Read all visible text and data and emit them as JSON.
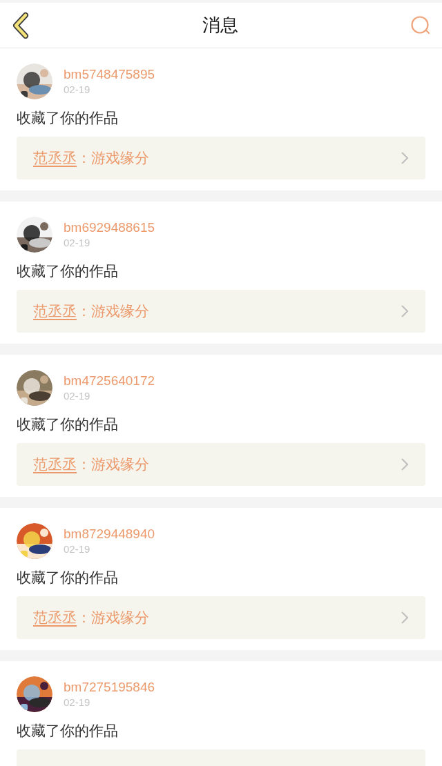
{
  "header": {
    "title": "消息"
  },
  "messages": [
    {
      "user": "bm5748475895",
      "date": "02-19",
      "action": "收藏了你的作品",
      "work": {
        "author": "范丞丞",
        "title": "：游戏缘分"
      }
    },
    {
      "user": "bm6929488615",
      "date": "02-19",
      "action": "收藏了你的作品",
      "work": {
        "author": "范丞丞",
        "title": "：游戏缘分"
      }
    },
    {
      "user": "bm4725640172",
      "date": "02-19",
      "action": "收藏了你的作品",
      "work": {
        "author": "范丞丞",
        "title": "：游戏缘分"
      }
    },
    {
      "user": "bm8729448940",
      "date": "02-19",
      "action": "收藏了你的作品",
      "work": {
        "author": "范丞丞",
        "title": "：游戏缘分"
      }
    },
    {
      "user": "bm7275195846",
      "date": "02-19",
      "action": "收藏了你的作品"
    }
  ]
}
